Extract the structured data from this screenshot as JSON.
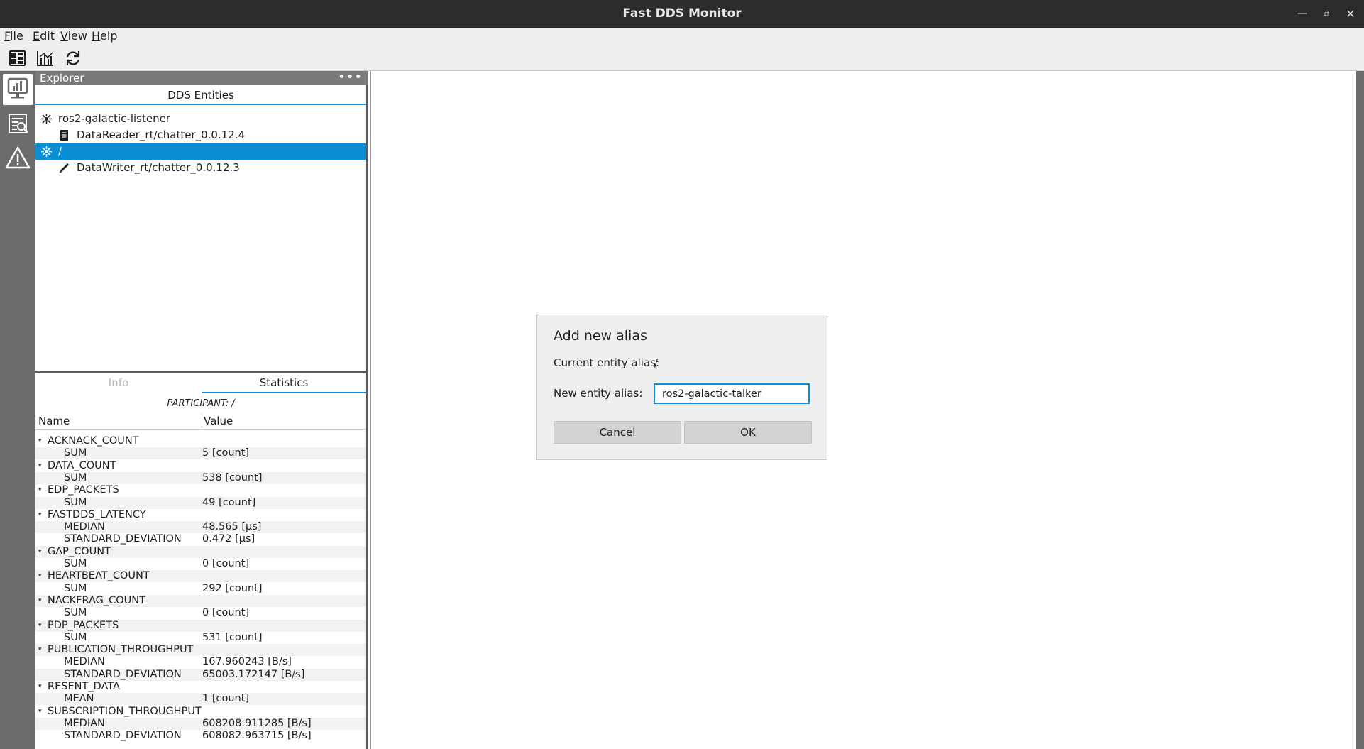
{
  "window": {
    "title": "Fast DDS Monitor"
  },
  "menu": [
    {
      "mnemonic": "F",
      "rest": "ile"
    },
    {
      "mnemonic": "E",
      "rest": "dit"
    },
    {
      "mnemonic": "V",
      "rest": "iew"
    },
    {
      "mnemonic": "H",
      "rest": "elp"
    }
  ],
  "toolbar": {
    "icons": [
      "dashboard-icon",
      "chart-icon",
      "refresh-icon"
    ]
  },
  "leftbar": {
    "icons": [
      "monitor-chart-icon",
      "search-log-icon",
      "warning-icon"
    ],
    "active": 0
  },
  "explorer": {
    "header": "Explorer",
    "more": "•••",
    "tab": "DDS Entities",
    "tree": [
      {
        "label": "ros2-galactic-listener",
        "icon": "participant-icon",
        "level": 0,
        "selected": false
      },
      {
        "label": "DataReader_rt/chatter_0.0.12.4",
        "icon": "datareader-icon",
        "level": 1,
        "selected": false
      },
      {
        "label": "/",
        "icon": "participant-icon",
        "level": 0,
        "selected": true
      },
      {
        "label": "DataWriter_rt/chatter_0.0.12.3",
        "icon": "datawriter-icon",
        "level": 1,
        "selected": false
      }
    ]
  },
  "stats": {
    "tabs": {
      "info": "Info",
      "statistics": "Statistics"
    },
    "participant": "PARTICIPANT: /",
    "columns": {
      "name": "Name",
      "value": "Value"
    },
    "groups": [
      {
        "name": "ACKNACK_COUNT",
        "rows": [
          {
            "name": "SUM",
            "value": "5 [count]"
          }
        ]
      },
      {
        "name": "DATA_COUNT",
        "rows": [
          {
            "name": "SUM",
            "value": "538 [count]"
          }
        ]
      },
      {
        "name": "EDP_PACKETS",
        "rows": [
          {
            "name": "SUM",
            "value": "49 [count]"
          }
        ]
      },
      {
        "name": "FASTDDS_LATENCY",
        "rows": [
          {
            "name": "MEDIAN",
            "value": "48.565 [μs]"
          },
          {
            "name": "STANDARD_DEVIATION",
            "value": "0.472 [μs]"
          }
        ]
      },
      {
        "name": "GAP_COUNT",
        "rows": [
          {
            "name": "SUM",
            "value": "0 [count]"
          }
        ]
      },
      {
        "name": "HEARTBEAT_COUNT",
        "rows": [
          {
            "name": "SUM",
            "value": "292 [count]"
          }
        ]
      },
      {
        "name": "NACKFRAG_COUNT",
        "rows": [
          {
            "name": "SUM",
            "value": "0 [count]"
          }
        ]
      },
      {
        "name": "PDP_PACKETS",
        "rows": [
          {
            "name": "SUM",
            "value": "531 [count]"
          }
        ]
      },
      {
        "name": "PUBLICATION_THROUGHPUT",
        "rows": [
          {
            "name": "MEDIAN",
            "value": "167.960243 [B/s]"
          },
          {
            "name": "STANDARD_DEVIATION",
            "value": "65003.172147 [B/s]"
          }
        ]
      },
      {
        "name": "RESENT_DATA",
        "rows": [
          {
            "name": "MEAN",
            "value": "1 [count]"
          }
        ]
      },
      {
        "name": "SUBSCRIPTION_THROUGHPUT",
        "rows": [
          {
            "name": "MEDIAN",
            "value": "608208.911285 [B/s]"
          },
          {
            "name": "STANDARD_DEVIATION",
            "value": "608082.963715 [B/s]"
          }
        ]
      }
    ]
  },
  "dialog": {
    "title": "Add new alias",
    "current_label": "Current entity alias:",
    "current_value": "/",
    "new_label": "New entity alias:",
    "new_value": "ros2-galactic-talker",
    "cancel": "Cancel",
    "ok": "OK"
  },
  "colors": {
    "accent": "#0f8dd3",
    "selection": "#0a8fd6",
    "titlebar": "#2c2c2c",
    "sidebar": "#6c6c6c"
  }
}
